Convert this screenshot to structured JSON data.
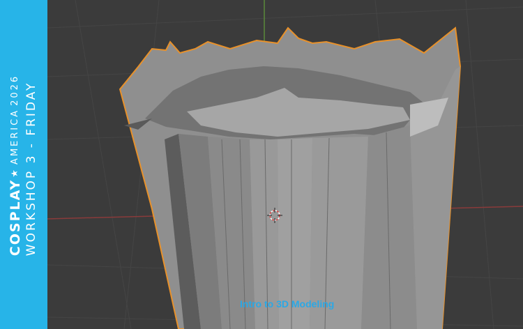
{
  "banner": {
    "brand_left": "COSPLAY",
    "brand_star": "★",
    "brand_middle": "AMERICA",
    "brand_year": "2026",
    "workshop": "WORKSHOP 3 - FRIDAY",
    "background_color": "#27b4e8"
  },
  "viewport": {
    "caption": "Intro to 3D Modeling",
    "selection_color": "#e8912a",
    "background_color": "#3b3b3b",
    "cursor_icon": "3d-cursor-icon"
  }
}
